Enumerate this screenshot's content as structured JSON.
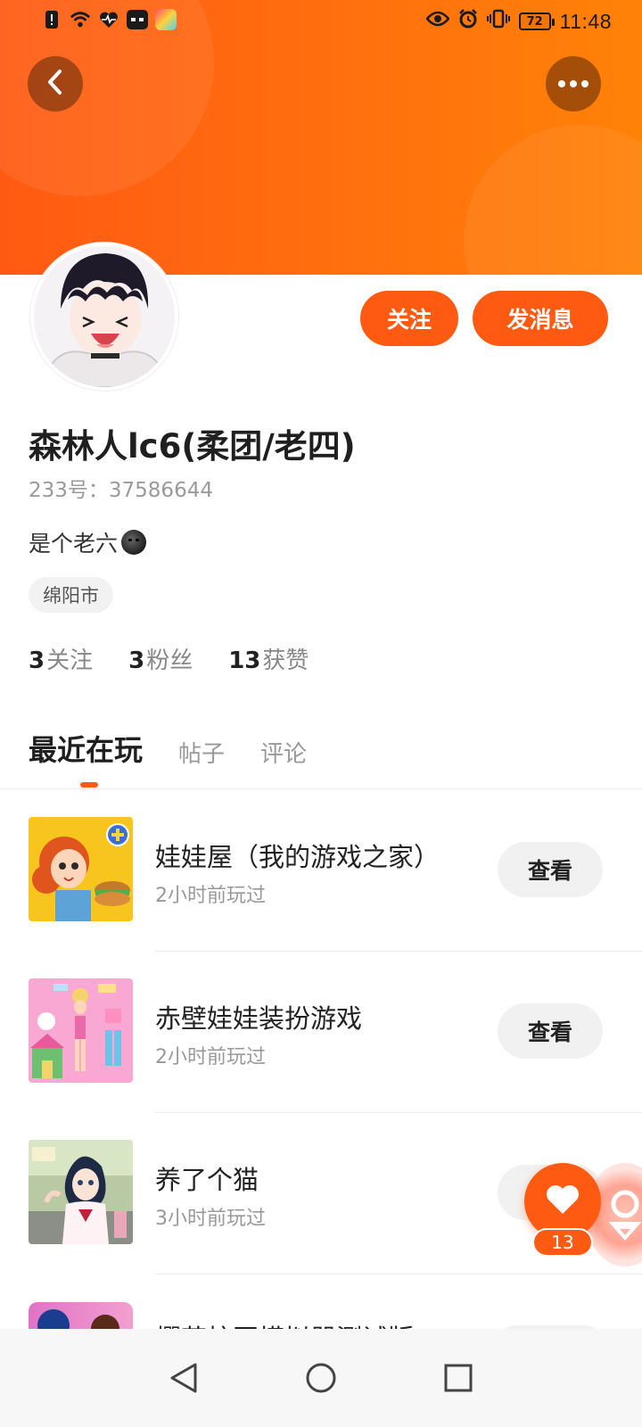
{
  "status_bar": {
    "time": "11:48",
    "battery": "72"
  },
  "profile": {
    "name": "森林人lc6(柔团/老四)",
    "uid": "233号：37586644",
    "bio": "是个老六",
    "location": "绵阳市",
    "follow_label": "关注",
    "message_label": "发消息",
    "stats": {
      "following_count": "3",
      "following_label": "关注",
      "followers_count": "3",
      "followers_label": "粉丝",
      "likes_count": "13",
      "likes_label": "获赞"
    }
  },
  "tabs": [
    {
      "label": "最近在玩",
      "active": true
    },
    {
      "label": "帖子",
      "active": false
    },
    {
      "label": "评论",
      "active": false
    }
  ],
  "games": [
    {
      "title": "娃娃屋（我的游戏之家）",
      "played": "2小时前玩过",
      "button": "查看"
    },
    {
      "title": "赤壁娃娃装扮游戏",
      "played": "2小时前玩过",
      "button": "查看"
    },
    {
      "title": "养了个猫",
      "played": "3小时前玩过",
      "button": "查看"
    }
  ],
  "partial_game_title": "樱花校园模拟器测试版",
  "like_fab": {
    "count": "13"
  },
  "colors": {
    "accent": "#ff5a12",
    "banner_start": "#ff5a12",
    "banner_end": "#ff8208"
  }
}
